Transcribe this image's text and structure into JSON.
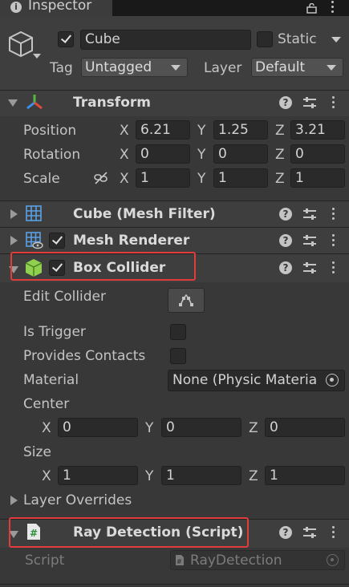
{
  "tab": {
    "title": "Inspector"
  },
  "object": {
    "enabled": true,
    "name": "Cube",
    "static_label": "Static",
    "static_checked": false,
    "tag_label": "Tag",
    "tag_value": "Untagged",
    "layer_label": "Layer",
    "layer_value": "Default"
  },
  "transform": {
    "title": "Transform",
    "position": {
      "label": "Position",
      "x": "6.21",
      "y": "1.25",
      "z": "3.21"
    },
    "rotation": {
      "label": "Rotation",
      "x": "0",
      "y": "0",
      "z": "0"
    },
    "scale": {
      "label": "Scale",
      "x": "1",
      "y": "1",
      "z": "1"
    }
  },
  "axes": {
    "x": "X",
    "y": "Y",
    "z": "Z"
  },
  "mesh_filter": {
    "title": "Cube (Mesh Filter)"
  },
  "mesh_renderer": {
    "title": "Mesh Renderer",
    "enabled": true
  },
  "box_collider": {
    "title": "Box Collider",
    "enabled": true,
    "edit_collider_label": "Edit Collider",
    "is_trigger_label": "Is Trigger",
    "is_trigger": false,
    "provides_contacts_label": "Provides Contacts",
    "provides_contacts": false,
    "material_label": "Material",
    "material_value": "None (Physic Materia",
    "center_label": "Center",
    "center": {
      "x": "0",
      "y": "0",
      "z": "0"
    },
    "size_label": "Size",
    "size": {
      "x": "1",
      "y": "1",
      "z": "1"
    },
    "layer_overrides_label": "Layer Overrides"
  },
  "ray_detection": {
    "title": "Ray Detection (Script)",
    "script_label": "Script",
    "script_value": "RayDetection"
  },
  "colors": {
    "highlight_box": "#e03c3c",
    "collider_green": "#8fd14f"
  }
}
